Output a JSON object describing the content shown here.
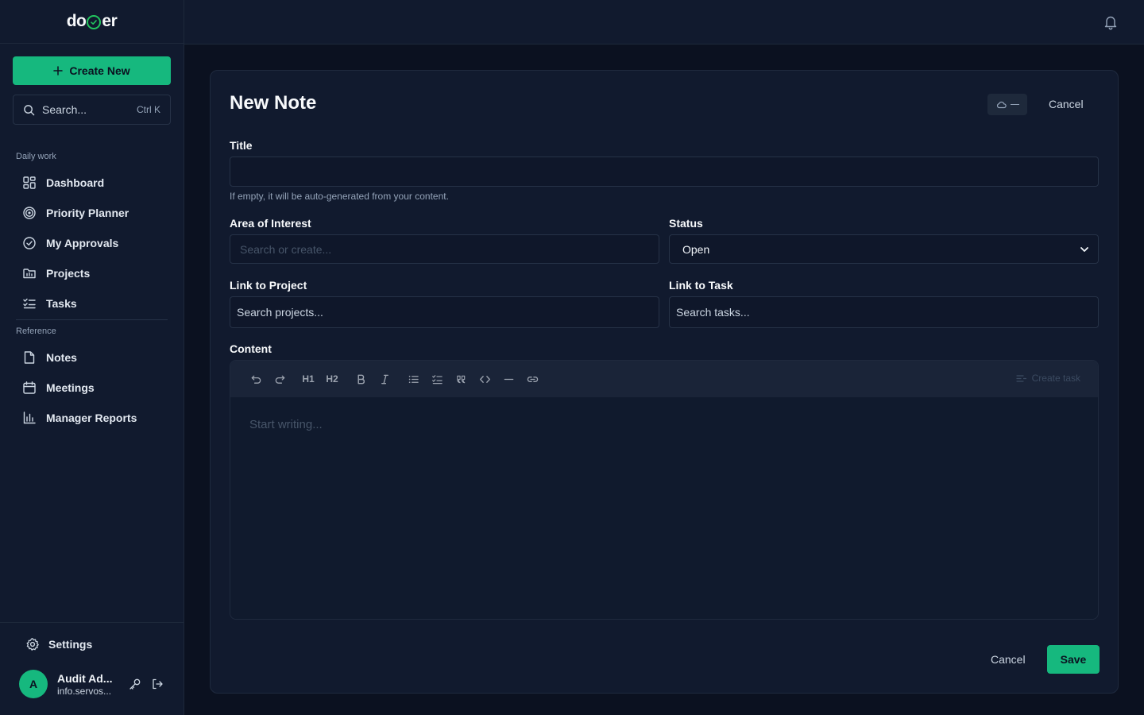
{
  "app": {
    "logo_left": "do",
    "logo_right": "er"
  },
  "sidebar": {
    "create_label": "Create New",
    "search_placeholder": "Search...",
    "search_shortcut": "Ctrl K",
    "sections": [
      {
        "label": "Daily work",
        "items": [
          {
            "label": "Dashboard",
            "icon": "grid-icon"
          },
          {
            "label": "Priority Planner",
            "icon": "target-icon"
          },
          {
            "label": "My Approvals",
            "icon": "check-circle-icon"
          },
          {
            "label": "Projects",
            "icon": "folder-chart-icon"
          },
          {
            "label": "Tasks",
            "icon": "list-checks-icon"
          }
        ]
      },
      {
        "label": "Reference",
        "items": [
          {
            "label": "Notes",
            "icon": "file-icon"
          },
          {
            "label": "Meetings",
            "icon": "calendar-icon"
          },
          {
            "label": "Manager Reports",
            "icon": "bar-chart-icon"
          }
        ]
      }
    ],
    "settings_label": "Settings",
    "user": {
      "initial": "A",
      "name": "Audit Ad...",
      "email": "info.servos..."
    }
  },
  "form": {
    "title": "New Note",
    "cancel_label": "Cancel",
    "title_label": "Title",
    "title_value": "",
    "title_helper": "If empty, it will be auto-generated from your content.",
    "area_label": "Area of Interest",
    "area_placeholder": "Search or create...",
    "status_label": "Status",
    "status_value": "Open",
    "project_label": "Link to Project",
    "project_placeholder": "Search projects...",
    "task_label": "Link to Task",
    "task_placeholder": "Search tasks...",
    "content_label": "Content",
    "editor": {
      "placeholder": "Start writing...",
      "create_task_label": "Create task",
      "h1_label": "H1",
      "h2_label": "H2"
    },
    "footer_cancel_label": "Cancel",
    "save_label": "Save"
  },
  "colors": {
    "accent": "#16b87e",
    "background": "#0b1120",
    "panel": "#111a2e"
  }
}
